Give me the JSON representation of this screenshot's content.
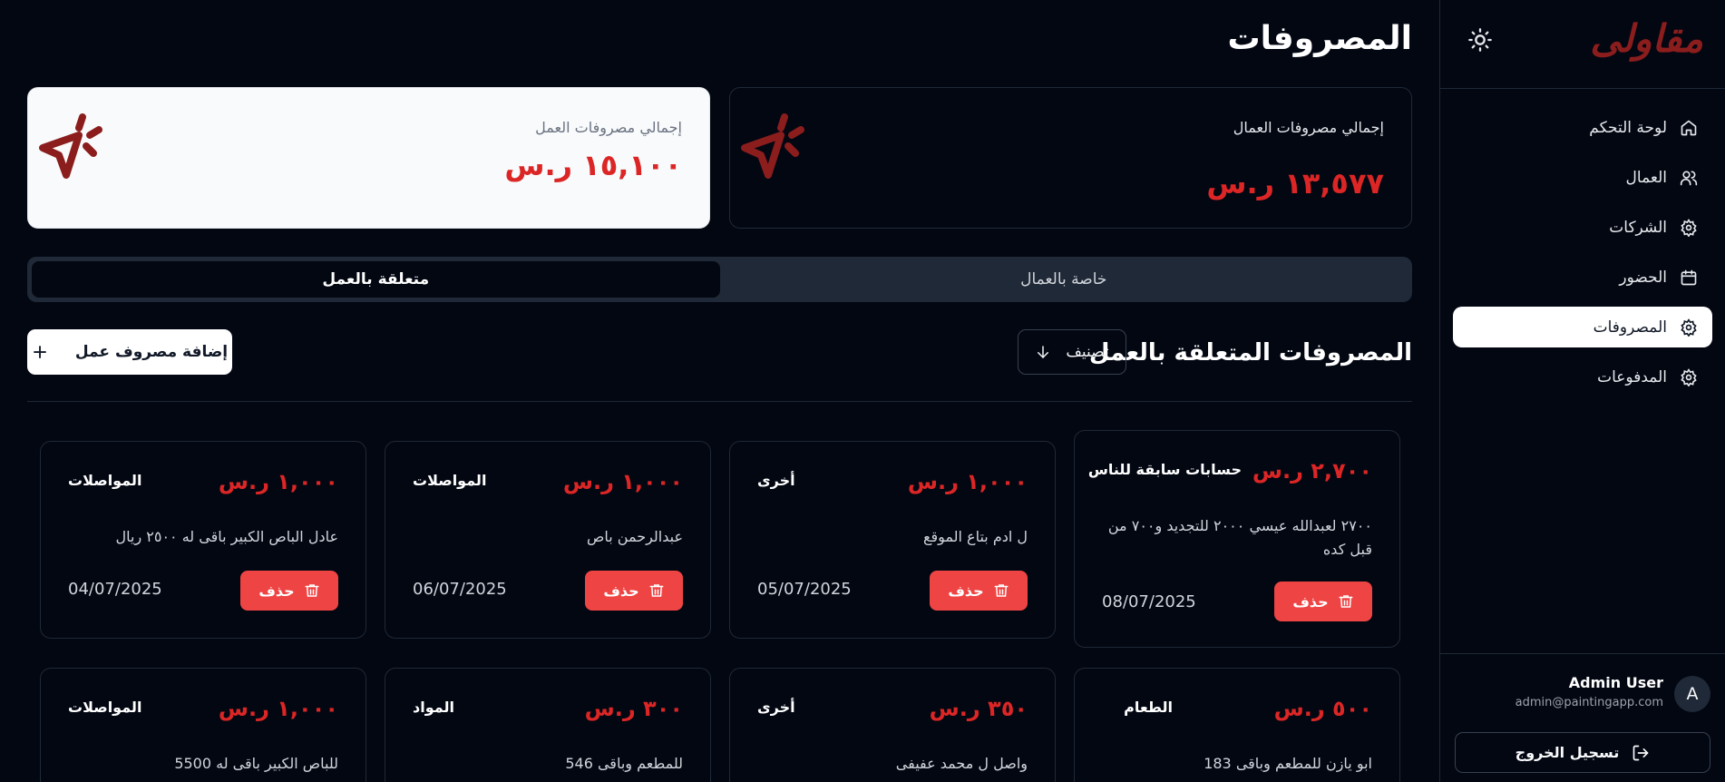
{
  "app": {
    "brand": "مقاولى"
  },
  "sidebar": {
    "items": [
      {
        "label": "لوحة التحكم",
        "icon": "home-icon"
      },
      {
        "label": "العمال",
        "icon": "users-icon"
      },
      {
        "label": "الشركات",
        "icon": "gear-icon"
      },
      {
        "label": "الحضور",
        "icon": "calendar-icon"
      },
      {
        "label": "المصروفات",
        "icon": "gear-icon",
        "active": true
      },
      {
        "label": "المدفوعات",
        "icon": "gear-icon"
      }
    ],
    "user": {
      "initial": "A",
      "name": "Admin User",
      "email": "admin@paintingapp.com"
    },
    "logout_label": "تسجيل الخروج"
  },
  "page": {
    "title": "المصروفات",
    "stats": {
      "workers": {
        "label": "إجمالي مصروفات العمال",
        "value": "١٣,٥٧٧ ر.س"
      },
      "work": {
        "label": "إجمالي مصروفات العمل",
        "value": "١٥,١٠٠ ر.س"
      }
    },
    "tabs": {
      "workers": "خاصة بالعمال",
      "work": "متعلقة بالعمل"
    },
    "section_title": "المصروفات المتعلقة بالعمل",
    "sort_label": "تصنيف",
    "add_label": "إضافة مصروف عمل",
    "delete_label": "حذف"
  },
  "expenses": [
    {
      "amount": "٢,٧٠٠ ر.س",
      "category": "حسابات سابقة للناس",
      "description": "٢٧٠٠ لعبدالله عيسي ٢٠٠٠ للتجديد و٧٠٠ من قبل كده",
      "date": "08/07/2025"
    },
    {
      "amount": "١,٠٠٠ ر.س",
      "category": "أخرى",
      "description": "ل ادم بتاع الموقع",
      "date": "05/07/2025"
    },
    {
      "amount": "١,٠٠٠ ر.س",
      "category": "المواصلات",
      "description": "عبدالرحمن باص",
      "date": "06/07/2025"
    },
    {
      "amount": "١,٠٠٠ ر.س",
      "category": "المواصلات",
      "description": "عادل الباص الكبير باقى له ٢٥٠٠ ريال",
      "date": "04/07/2025"
    },
    {
      "amount": "٥٠٠ ر.س",
      "category": "الطعام",
      "description": "ابو يازن للمطعم وباقى 183",
      "date": ""
    },
    {
      "amount": "٣٥٠ ر.س",
      "category": "أخرى",
      "description": "واصل ل محمد عفيفى",
      "date": ""
    },
    {
      "amount": "٣٠٠ ر.س",
      "category": "المواد",
      "description": "للمطعم وباقى 546",
      "date": ""
    },
    {
      "amount": "١,٠٠٠ ر.س",
      "category": "المواصلات",
      "description": "للباص الكبير باقى له 5500",
      "date": ""
    }
  ],
  "colors": {
    "background": "#030712",
    "accent_red": "#dc2626",
    "delete_button": "#ef4444",
    "brand": "#8b1d1d"
  }
}
